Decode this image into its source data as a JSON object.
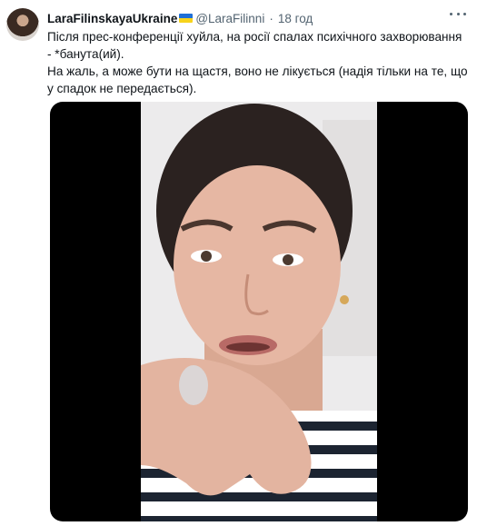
{
  "author": {
    "display_name": "LaraFilinskayaUkraine",
    "flag_icon": "ukraine-flag-icon",
    "handle": "@LaraFilinni",
    "separator": "·",
    "time": "18 год"
  },
  "tweet": {
    "lines": [
      "Після прес-конференції хуйла, на росії спалах психічного захворювання",
      "- *банута(ий).",
      "На жаль, а може бути на щастя, воно не лікується (надія тільки на те, що",
      "у спадок не передається)."
    ]
  },
  "media": {
    "type": "video",
    "description_icon": "video-frame"
  },
  "colors": {
    "text": "#0f1419",
    "secondary": "#536471",
    "media_bg": "#000000"
  }
}
